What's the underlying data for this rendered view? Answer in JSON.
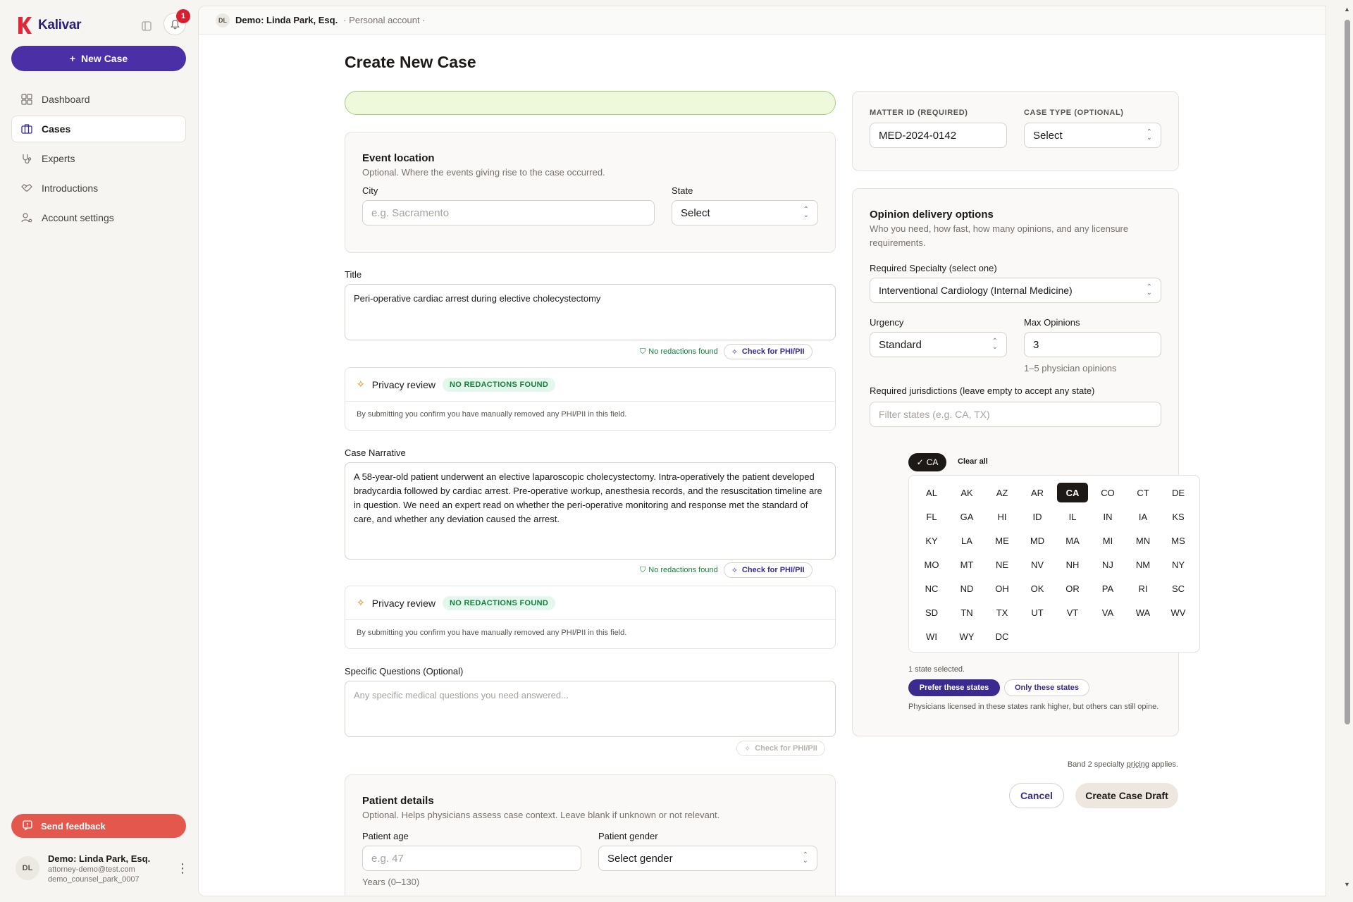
{
  "brand": {
    "name": "Kalivar"
  },
  "notifications": {
    "count": "1"
  },
  "sidebar": {
    "new_case": "New Case",
    "items": [
      {
        "label": "Dashboard",
        "icon": "grid-icon"
      },
      {
        "label": "Cases",
        "icon": "briefcase-icon"
      },
      {
        "label": "Experts",
        "icon": "stethoscope-icon"
      },
      {
        "label": "Introductions",
        "icon": "handshake-icon"
      },
      {
        "label": "Account settings",
        "icon": "user-gear-icon"
      }
    ],
    "feedback": "Send feedback",
    "user": {
      "initials": "DL",
      "name": "Demo: Linda Park, Esq.",
      "email": "attorney-demo@test.com",
      "handle": "demo_counsel_park_0007"
    }
  },
  "topbar": {
    "initials": "DL",
    "name": "Demo: Linda Park, Esq.",
    "account": "· Personal account ·"
  },
  "page": {
    "title": "Create New Case"
  },
  "event_location": {
    "title": "Event location",
    "subtitle": "Optional. Where the events giving rise to the case occurred.",
    "city_label": "City",
    "city_placeholder": "e.g. Sacramento",
    "state_label": "State",
    "state_value": "Select"
  },
  "title_field": {
    "label": "Title",
    "value": "Peri-operative cardiac arrest during elective cholecystectomy"
  },
  "phi": {
    "status": "No redactions found",
    "button": "Check for PHI/PII"
  },
  "privacy": {
    "title": "Privacy review",
    "badge": "NO REDACTIONS FOUND",
    "note": "By submitting you confirm you have manually removed any PHI/PII in this field."
  },
  "narrative": {
    "label": "Case Narrative",
    "value": "A 58-year-old patient underwent an elective laparoscopic cholecystectomy. Intra-operatively the patient developed bradycardia followed by cardiac arrest. Pre-operative workup, anesthesia records, and the resuscitation timeline are in question. We need an expert read on whether the peri-operative monitoring and response met the standard of care, and whether any deviation caused the arrest."
  },
  "questions": {
    "label": "Specific Questions (Optional)",
    "placeholder": "Any specific medical questions you need answered..."
  },
  "patient": {
    "title": "Patient details",
    "subtitle": "Optional. Helps physicians assess case context. Leave blank if unknown or not relevant.",
    "age_label": "Patient age",
    "age_placeholder": "e.g. 47",
    "age_hint": "Years (0–130)",
    "gender_label": "Patient gender",
    "gender_value": "Select gender"
  },
  "matter": {
    "id_label": "MATTER ID (REQUIRED)",
    "id_value": "MED-2024-0142",
    "type_label": "CASE TYPE (OPTIONAL)",
    "type_value": "Select"
  },
  "opinion": {
    "title": "Opinion delivery options",
    "subtitle": "Who you need, how fast, how many opinions, and any licensure requirements.",
    "specialty_label": "Required Specialty (select one)",
    "specialty_value": "Interventional Cardiology (Internal Medicine)",
    "urgency_label": "Urgency",
    "urgency_value": "Standard",
    "max_label": "Max Opinions",
    "max_value": "3",
    "max_hint": "1–5 physician opinions",
    "juris_label": "Required jurisdictions (leave empty to accept any state)",
    "juris_placeholder": "Filter states (e.g. CA, TX)",
    "chip": "CA",
    "clear_all": "Clear all",
    "states": [
      "AL",
      "AK",
      "AZ",
      "AR",
      "CA",
      "CO",
      "CT",
      "DE",
      "FL",
      "GA",
      "HI",
      "ID",
      "IL",
      "IN",
      "IA",
      "KS",
      "KY",
      "LA",
      "ME",
      "MD",
      "MA",
      "MI",
      "MN",
      "MS",
      "MO",
      "MT",
      "NE",
      "NV",
      "NH",
      "NJ",
      "NM",
      "NY",
      "NC",
      "ND",
      "OH",
      "OK",
      "OR",
      "PA",
      "RI",
      "SC",
      "SD",
      "TN",
      "TX",
      "UT",
      "VT",
      "VA",
      "WA",
      "WV",
      "WI",
      "WY",
      "DC"
    ],
    "selected_states": [
      "CA"
    ],
    "selected_count": "1 state selected.",
    "prefer": "Prefer these states",
    "only": "Only these states",
    "hint": "Physicians licensed in these states rank higher, but others can still opine."
  },
  "pricing": {
    "prefix": "Band 2 specialty ",
    "link": "pricing",
    "suffix": " applies."
  },
  "actions": {
    "cancel": "Cancel",
    "create": "Create Case Draft"
  },
  "colors": {
    "accent": "#4a2fa6",
    "feedback": "#e4574c",
    "success": "#15803d"
  }
}
